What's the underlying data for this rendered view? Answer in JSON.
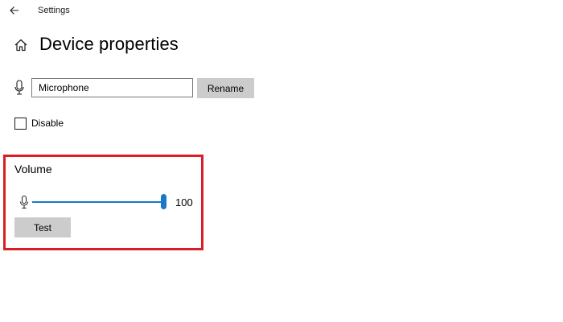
{
  "window": {
    "title": "Settings",
    "back_icon": "arrow-left-icon"
  },
  "header": {
    "home_icon": "home-icon",
    "title": "Device properties"
  },
  "name": {
    "icon": "microphone-icon",
    "value": "Microphone",
    "rename_label": "Rename"
  },
  "disable": {
    "label": "Disable",
    "checked": false
  },
  "volume": {
    "heading": "Volume",
    "icon": "microphone-icon",
    "value": "100",
    "level_percent": 100,
    "test_label": "Test"
  },
  "colors": {
    "accent": "#1979c9",
    "highlight_border": "#d81f26",
    "button_bg": "#cccccc"
  }
}
